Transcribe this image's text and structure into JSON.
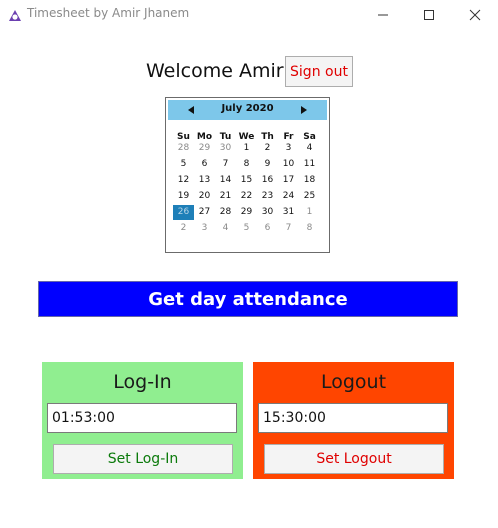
{
  "window": {
    "title": "Timesheet by Amir Jhanem",
    "icon": "app-logo-icon",
    "controls": [
      "minimize-icon",
      "maximize-icon",
      "close-icon"
    ]
  },
  "header": {
    "welcome_text": "Welcome Amir",
    "signout_label": "Sign out"
  },
  "calendar": {
    "month_label": "July 2020",
    "day_headers": [
      "Su",
      "Mo",
      "Tu",
      "We",
      "Th",
      "Fr",
      "Sa"
    ],
    "weeks": [
      [
        "28",
        "29",
        "30",
        "1",
        "2",
        "3",
        "4"
      ],
      [
        "5",
        "6",
        "7",
        "8",
        "9",
        "10",
        "11"
      ],
      [
        "12",
        "13",
        "14",
        "15",
        "16",
        "17",
        "18"
      ],
      [
        "19",
        "20",
        "21",
        "22",
        "23",
        "24",
        "25"
      ],
      [
        "26",
        "27",
        "28",
        "29",
        "30",
        "31",
        "1"
      ],
      [
        "2",
        "3",
        "4",
        "5",
        "6",
        "7",
        "8"
      ]
    ],
    "selected_date": "26"
  },
  "attendance_button_label": "Get day attendance",
  "login_panel": {
    "title": "Log-In",
    "time_value": "01:53:00",
    "button_label": "Set Log-In"
  },
  "logout_panel": {
    "title": "Logout",
    "time_value": "15:30:00",
    "button_label": "Set Logout"
  },
  "colors": {
    "calendar_header": "#7dc7ea",
    "attendance_button": "#0000ff",
    "login_panel": "#90ee90",
    "logout_panel": "#ff4500",
    "selected_day": "#1e7fb8"
  }
}
